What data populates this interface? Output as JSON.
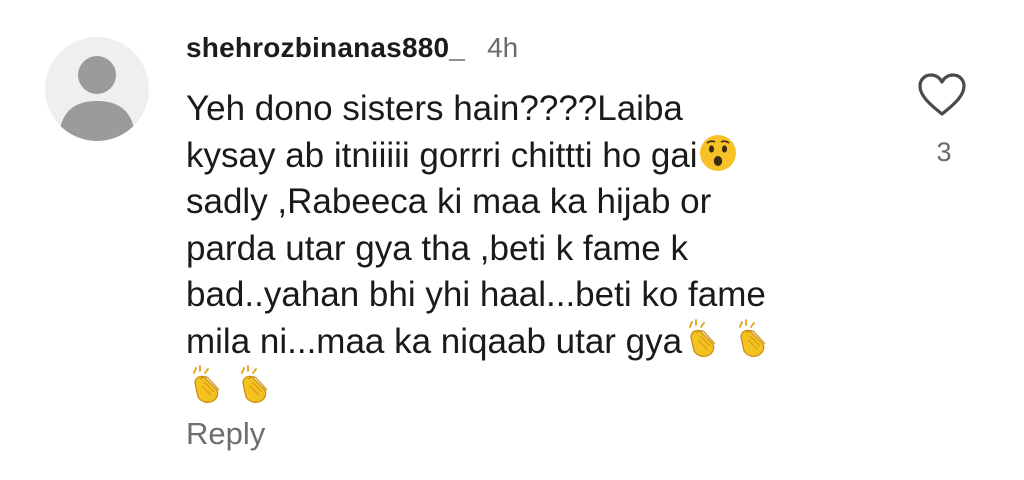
{
  "comment": {
    "username": "shehrozbinanas880_",
    "timestamp": "4h",
    "lines": [
      "Yeh dono sisters hain????Laiba",
      "kysay ab itniiiii gorrri chittti ho gai",
      "sadly ,Rabeeca ki maa ka hijab or",
      "parda utar gya tha ,beti k fame k",
      "bad..yahan bhi yhi haal...beti ko fame",
      "mila ni...maa ka niqaab utar gya"
    ],
    "emojis": {
      "line2_end": "astonished-face-icon",
      "line6_end": [
        "clapping-hands-icon",
        "clapping-hands-icon"
      ],
      "line7": [
        "clapping-hands-icon",
        "clapping-hands-icon"
      ]
    },
    "reply_label": "Reply",
    "like_count": "3"
  },
  "colors": {
    "text": "#1a1a1a",
    "muted": "#6b6b6b",
    "avatar_bg": "#efefef",
    "avatar_fg": "#9b9b9b",
    "emoji_yellow": "#f7c227"
  }
}
